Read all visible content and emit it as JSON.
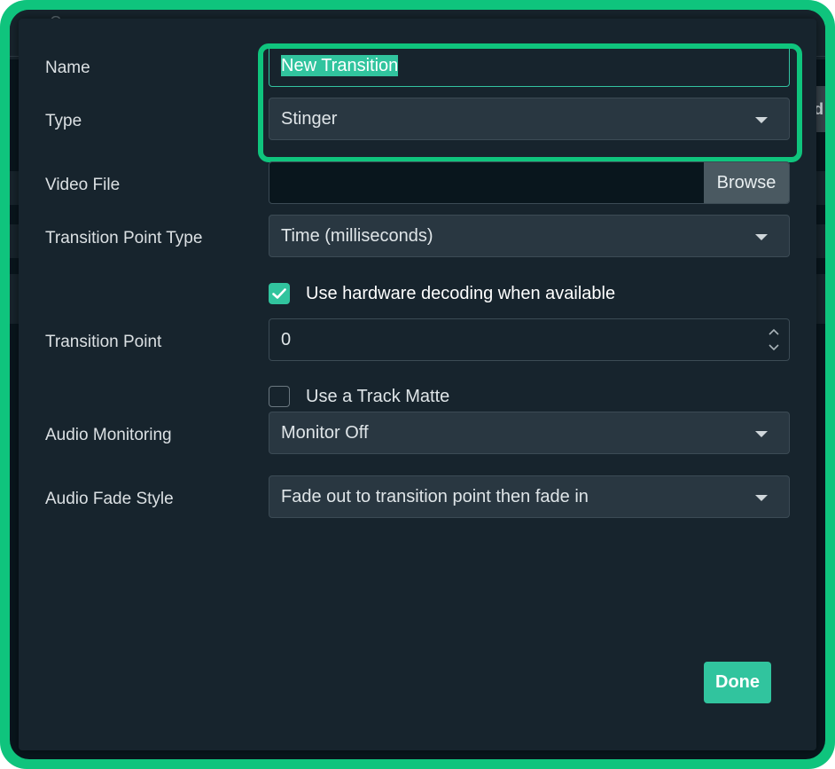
{
  "background_app": {
    "title_partial": "Ca",
    "button_partial": "d"
  },
  "form": {
    "name": {
      "label": "Name",
      "value": "New Transition"
    },
    "type": {
      "label": "Type",
      "value": "Stinger"
    },
    "video_file": {
      "label": "Video File",
      "value": "",
      "browse_label": "Browse"
    },
    "transition_point_type": {
      "label": "Transition Point Type",
      "value": "Time (milliseconds)"
    },
    "hardware_decoding": {
      "label": "Use hardware decoding when available",
      "checked": true
    },
    "transition_point": {
      "label": "Transition Point",
      "value": "0"
    },
    "track_matte": {
      "label": "Use a Track Matte",
      "checked": false
    },
    "audio_monitoring": {
      "label": "Audio Monitoring",
      "value": "Monitor Off"
    },
    "audio_fade_style": {
      "label": "Audio Fade Style",
      "value": "Fade out to transition point then fade in"
    }
  },
  "footer": {
    "done_label": "Done"
  },
  "colors": {
    "accent": "#31c49e",
    "highlight_outline": "#0fc47d",
    "modal_bg": "#17242d",
    "input_bg": "#293741"
  },
  "icons": {
    "dropdown": "chevron-down-icon",
    "checkbox_checked": "checkmark-icon",
    "number_spinner": "spinner-arrows-icon"
  }
}
